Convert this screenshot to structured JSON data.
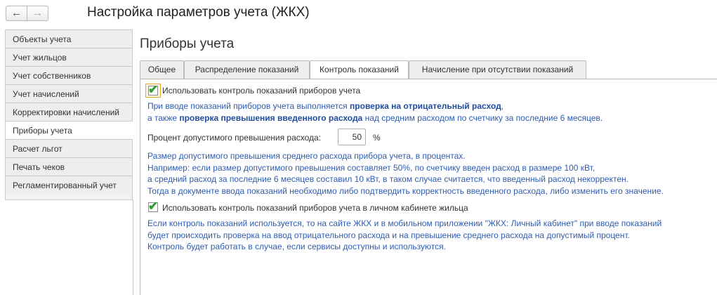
{
  "window": {
    "title": "Настройка параметров учета (ЖКХ)",
    "back_icon": "arrow-left-icon",
    "forward_icon": "arrow-right-icon"
  },
  "sidebar": {
    "items": [
      {
        "label": "Объекты учета",
        "active": false
      },
      {
        "label": "Учет жильцов",
        "active": false
      },
      {
        "label": "Учет собственников",
        "active": false
      },
      {
        "label": "Учет начислений",
        "active": false
      },
      {
        "label": "Корректировки начислений",
        "active": false
      },
      {
        "label": "Приборы учета",
        "active": true
      },
      {
        "label": "Расчет льгот",
        "active": false
      },
      {
        "label": "Печать чеков",
        "active": false
      },
      {
        "label": "Регламентированный учет",
        "active": false
      }
    ]
  },
  "main": {
    "title": "Приборы учета",
    "tabs": [
      {
        "label": "Общее",
        "active": false
      },
      {
        "label": "Распределение показаний",
        "active": false
      },
      {
        "label": "Контроль показаний",
        "active": true
      },
      {
        "label": "Начисление при отсутствии показаний",
        "active": false
      }
    ],
    "control": {
      "checkbox_label": "Использовать контроль показаний приборов учета",
      "checked": true,
      "info_line1_prefix": "При вводе показаний приборов учета выполняется ",
      "info_line1_bold": "проверка на отрицательный расход",
      "info_line1_suffix": ",",
      "info_line2_prefix": "а также ",
      "info_line2_bold": "проверка превышения введенного расхода",
      "info_line2_suffix": " над средним расходом по счетчику за последние 6 месяцев."
    },
    "percent": {
      "label": "Процент допустимого превышения расхода:",
      "value": "50",
      "unit": "%"
    },
    "percent_info": [
      "Размер допустимого превышения среднего расхода прибора учета, в процентах.",
      "Например: если  размер допустимого превышения составляет 50%,  по счетчику введен расход в размере 100 кВт,",
      "а средний расход за последние 6 месяцев составил 10 кВт, в таком случае считается, что введенный расход некорректен.",
      "Тогда в документе ввода показаний необходимо либо подтвердить корректность введенного расхода, либо изменить его значение."
    ],
    "cabinet": {
      "checkbox_label": "Использовать контроль показаний приборов учета в личном кабинете жильца",
      "checked": true,
      "info": [
        "Если контроль показаний используется, то на сайте ЖКХ и в мобильном приложении \"ЖКХ: Личный кабинет\" при вводе показаний",
        "будет происходить проверка на ввод отрицательного расхода и на превышение среднего расхода на допустимый процент.",
        "Контроль будет работать в случае, если сервисы доступны и используются."
      ]
    },
    "accent_color": "#2e5cb0",
    "check_color": "#2e9e2e"
  }
}
